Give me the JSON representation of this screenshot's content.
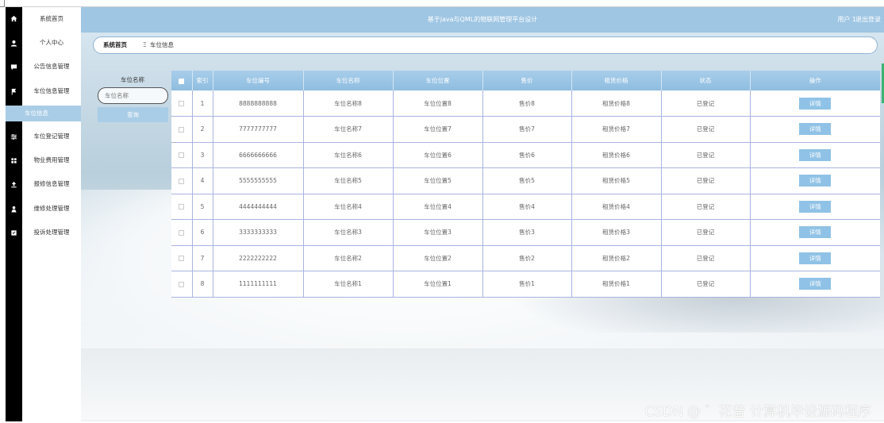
{
  "header": {
    "title": "基于java与QML的物联网管理平台设计",
    "user": "用户 1",
    "logout": "退出登录"
  },
  "sidebar": {
    "icons": [
      "home-icon",
      "user-icon",
      "comment-icon",
      "flag-icon",
      "",
      "sliders-icon",
      "grid-icon",
      "upload-icon",
      "person-icon",
      "checkbox-icon"
    ],
    "items": [
      {
        "label": "系统首页"
      },
      {
        "label": "个人中心"
      },
      {
        "label": "公告信息管理"
      },
      {
        "label": "车位信息管理"
      },
      {
        "label": "车位信息",
        "active": true
      },
      {
        "label": "车位登记管理"
      },
      {
        "label": "物业费用管理"
      },
      {
        "label": "报修信息管理"
      },
      {
        "label": "维修处理管理"
      },
      {
        "label": "投诉处理管理"
      }
    ]
  },
  "breadcrumb": {
    "home": "系统首页",
    "separator": "Ξ",
    "current": "车位信息"
  },
  "search": {
    "label": "车位名称",
    "placeholder": "车位名称",
    "button": "查询"
  },
  "table": {
    "headers": [
      "索引",
      "车位编号",
      "车位名称",
      "车位位置",
      "售价",
      "租赁价格",
      "状态",
      "操作"
    ],
    "rows": [
      {
        "index": "1",
        "number": "8888888888",
        "name": "车位名称8",
        "location": "车位位置8",
        "price": "售价8",
        "rent": "租赁价格8",
        "status": "已登记",
        "action": "详情"
      },
      {
        "index": "2",
        "number": "7777777777",
        "name": "车位名称7",
        "location": "车位位置7",
        "price": "售价7",
        "rent": "租赁价格7",
        "status": "已登记",
        "action": "详情"
      },
      {
        "index": "3",
        "number": "6666666666",
        "name": "车位名称6",
        "location": "车位位置6",
        "price": "售价6",
        "rent": "租赁价格6",
        "status": "已登记",
        "action": "详情"
      },
      {
        "index": "4",
        "number": "5555555555",
        "name": "车位名称5",
        "location": "车位位置5",
        "price": "售价5",
        "rent": "租赁价格5",
        "status": "已登记",
        "action": "详情"
      },
      {
        "index": "5",
        "number": "4444444444",
        "name": "车位名称4",
        "location": "车位位置4",
        "price": "售价4",
        "rent": "租赁价格4",
        "status": "已登记",
        "action": "详情"
      },
      {
        "index": "6",
        "number": "3333333333",
        "name": "车位名称3",
        "location": "车位位置3",
        "price": "售价3",
        "rent": "租赁价格3",
        "status": "已登记",
        "action": "详情"
      },
      {
        "index": "7",
        "number": "2222222222",
        "name": "车位名称2",
        "location": "车位位置2",
        "price": "售价2",
        "rent": "租赁价格2",
        "status": "已登记",
        "action": "详情"
      },
      {
        "index": "8",
        "number": "1111111111",
        "name": "车位名称1",
        "location": "车位位置1",
        "price": "售价1",
        "rent": "租赁价格1",
        "status": "已登记",
        "action": "详情"
      }
    ]
  },
  "watermark": "CSDN @ ゛花昔 计算机毕设源码程序",
  "colors": {
    "header": "#9fc6e3",
    "accent": "#a9cde6",
    "sidebar_icons_bg": "#000000"
  }
}
